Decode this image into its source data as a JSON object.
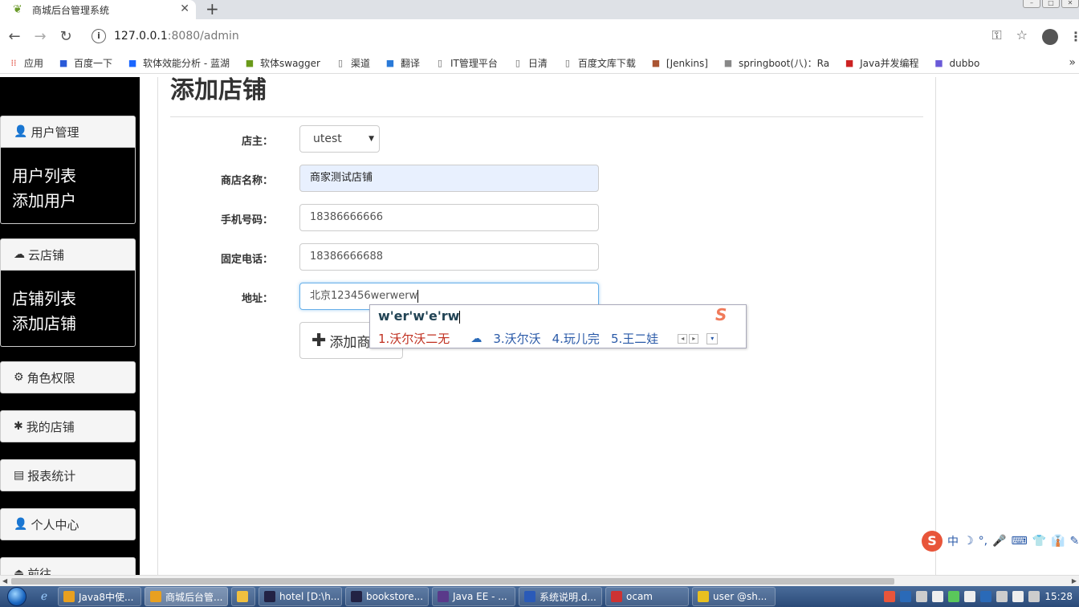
{
  "browser": {
    "tab_title": "商城后台管理系统",
    "tab_close": "✕",
    "new_tab": "+",
    "url_host": "127.0.0.1",
    "url_path": ":8080/admin",
    "bookmarks": [
      {
        "icon": "apps-icon",
        "label": "应用",
        "color": "#e04a3a"
      },
      {
        "icon": "paw-icon",
        "label": "百度一下",
        "color": "#2a5ad8"
      },
      {
        "icon": "lanhu-icon",
        "label": "软体效能分析 - 蓝湖",
        "color": "#1a66ff"
      },
      {
        "icon": "swagger-icon",
        "label": "软体swagger",
        "color": "#6a9a1a"
      },
      {
        "icon": "page-icon",
        "label": "渠道",
        "color": "#666666"
      },
      {
        "icon": "translate-icon",
        "label": "翻译",
        "color": "#2a7ad8"
      },
      {
        "icon": "page-icon",
        "label": "IT管理平台",
        "color": "#666666"
      },
      {
        "icon": "page-icon",
        "label": "日清",
        "color": "#666666"
      },
      {
        "icon": "page-icon",
        "label": "百度文库下载",
        "color": "#666666"
      },
      {
        "icon": "jenkins-icon",
        "label": "[Jenkins]",
        "color": "#aa5533"
      },
      {
        "icon": "springboot-icon",
        "label": "springboot(八)：Ra",
        "color": "#888888"
      },
      {
        "icon": "csdn-icon",
        "label": "Java并发编程",
        "color": "#cc2222"
      },
      {
        "icon": "dubbo-icon",
        "label": "dubbo",
        "color": "#6a5ad8"
      }
    ],
    "bookmarks_more": "»"
  },
  "sidebar": {
    "groups": [
      {
        "icon": "user-icon",
        "glyph": "👤",
        "title": "用户管理",
        "links": [
          "用户列表",
          "添加用户"
        ]
      },
      {
        "icon": "cloud-icon",
        "glyph": "☁",
        "title": "云店铺",
        "links": [
          "店铺列表",
          "添加店铺"
        ]
      }
    ],
    "singles": [
      {
        "icon": "gear-icon",
        "glyph": "⚙",
        "title": "角色权限"
      },
      {
        "icon": "asterisk-icon",
        "glyph": "✱",
        "title": "我的店铺"
      },
      {
        "icon": "list-icon",
        "glyph": "▤",
        "title": "报表统计"
      },
      {
        "icon": "user-icon",
        "glyph": "👤",
        "title": "个人中心"
      },
      {
        "icon": "eject-icon",
        "glyph": "⏏",
        "title": "前往"
      }
    ]
  },
  "page": {
    "title": "添加店铺",
    "form": {
      "owner_label": "店主：",
      "owner_value": "utest",
      "name_label": "商店名称：",
      "name_value": "商家测试店铺",
      "phone_label": "手机号码：",
      "phone_value": "18386666666",
      "tel_label": "固定电话：",
      "tel_value": "18386666688",
      "address_label": "地址：",
      "address_value": "北京123456werwerw",
      "submit_label": "添加商铺"
    }
  },
  "ime": {
    "composition": "w'er'w'e'rw",
    "candidates": [
      "1.沃尔沃二无",
      "3.沃尔沃",
      "4.玩儿完",
      "5.王二娃"
    ],
    "logo": "S"
  },
  "ime_bar": {
    "logo": "S",
    "items": [
      "中",
      "☽",
      "°,",
      "🎤",
      "⌨",
      "👕",
      "👔",
      "✎"
    ]
  },
  "taskbar": {
    "items": [
      {
        "label": "Java8中使...",
        "color": "#e8a020"
      },
      {
        "label": "商城后台管...",
        "color": "#e8a020",
        "active": true
      },
      {
        "label": "",
        "color": "#f0c040"
      },
      {
        "label": "hotel [D:\\h...",
        "color": "#222244"
      },
      {
        "label": "bookstore...",
        "color": "#222244"
      },
      {
        "label": "Java EE - ...",
        "color": "#5a3a8a"
      },
      {
        "label": "系统说明.d...",
        "color": "#2a5ab8"
      },
      {
        "label": "ocam",
        "color": "#cc3333"
      },
      {
        "label": "user @sh...",
        "color": "#e8c020"
      }
    ],
    "clock": "15:28"
  }
}
